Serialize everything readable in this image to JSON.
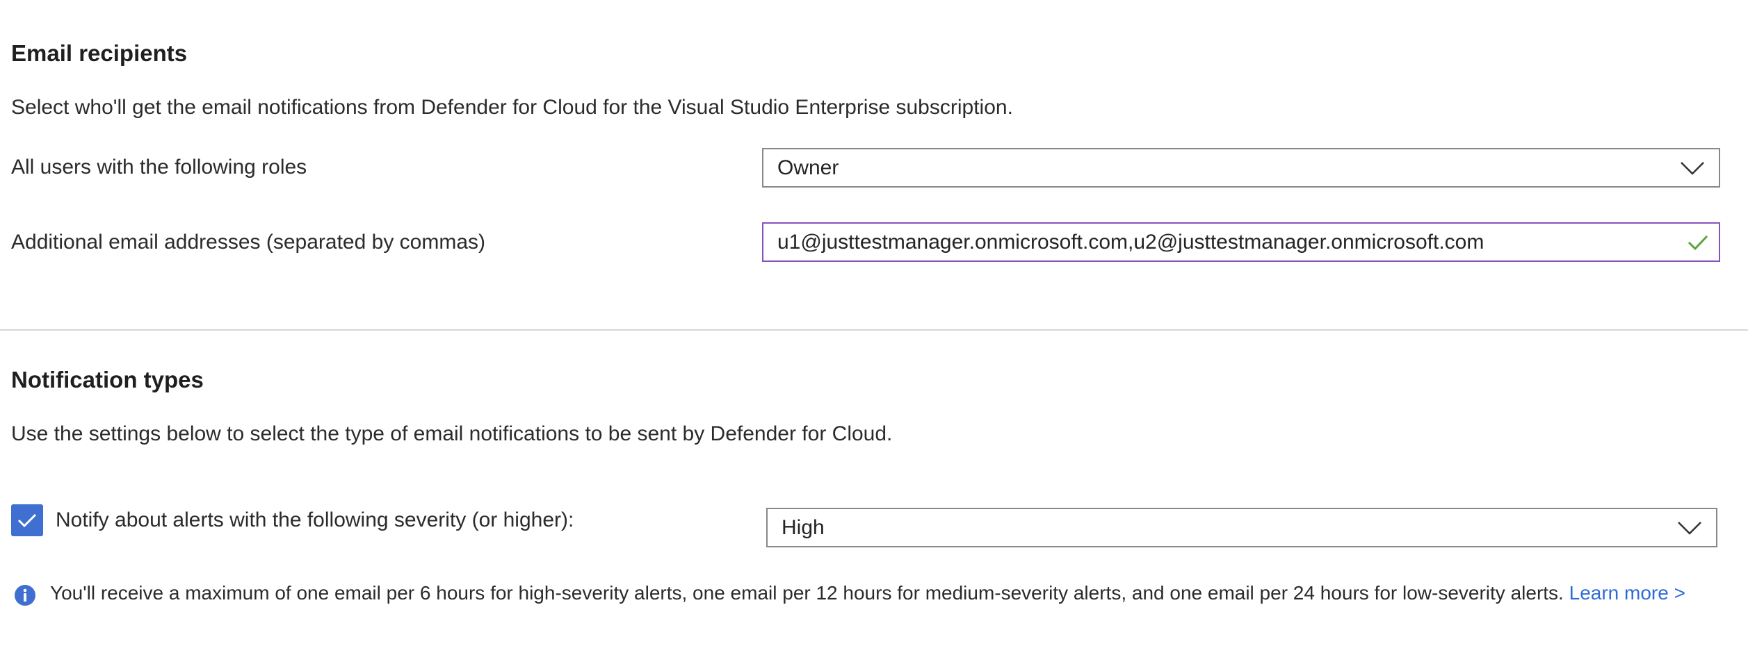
{
  "email_recipients": {
    "title": "Email recipients",
    "description": "Select who'll get the email notifications from Defender for Cloud for the Visual Studio Enterprise subscription.",
    "roles_label": "All users with the following roles",
    "roles_value": "Owner",
    "emails_label": "Additional email addresses (separated by commas)",
    "emails_value": "u1@justtestmanager.onmicrosoft.com,u2@justtestmanager.onmicrosoft.com"
  },
  "notification_types": {
    "title": "Notification types",
    "description": "Use the settings below to select the type of email notifications to be sent by Defender for Cloud.",
    "severity_checkbox_label": "Notify about alerts with the following severity (or higher):",
    "severity_checked": true,
    "severity_value": "High",
    "info_text": "You'll receive a maximum of one email per 6 hours for high-severity alerts, one email per 12 hours for medium-severity alerts, and one email per 24 hours for low-severity alerts.",
    "learn_more": "Learn more >"
  },
  "colors": {
    "accent": "#3f6fd1",
    "valid_check": "#5aa33b",
    "input_focus_border": "#8a4fbf",
    "link": "#2f6bd6"
  },
  "icons": [
    "chevron-down-icon",
    "checkmark-icon",
    "info-icon"
  ]
}
